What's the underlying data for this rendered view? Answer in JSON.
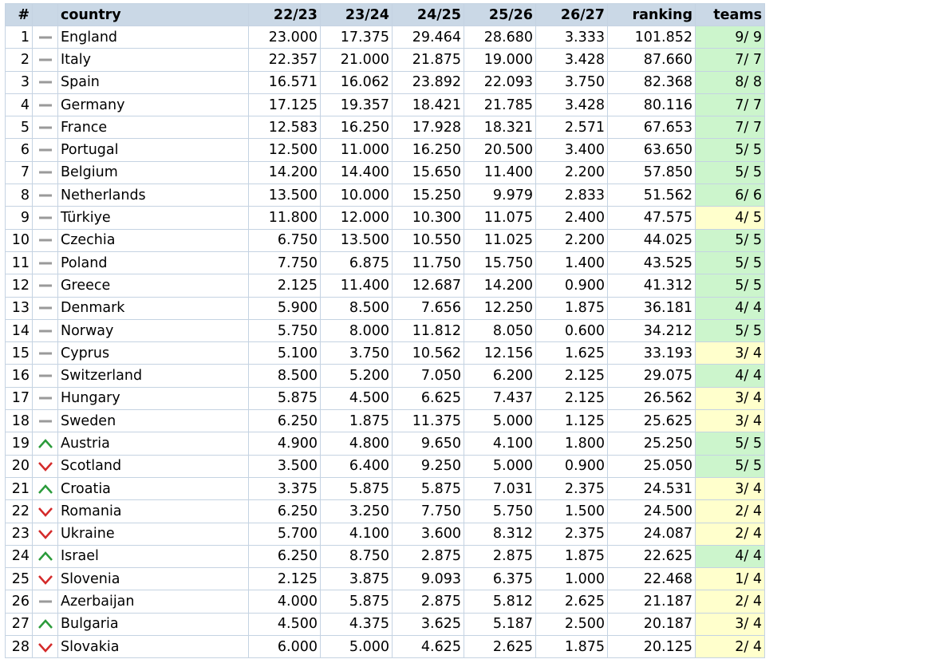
{
  "columns": [
    "#",
    "",
    "country",
    "22/23",
    "23/24",
    "24/25",
    "25/26",
    "26/27",
    "ranking",
    "teams"
  ],
  "colors": {
    "header_bg": "#cad8e6",
    "grid": "#c5d3e2",
    "teams_full": "#ccf5cc",
    "teams_partial": "#ffffcc",
    "trend_up": "#2a9b3a",
    "trend_down": "#d42a2a",
    "trend_same": "#9a9a9a"
  },
  "rows": [
    {
      "rank": "1",
      "trend": "same",
      "country": "England",
      "s1": "23.000",
      "s2": "17.375",
      "s3": "29.464",
      "s4": "28.680",
      "s5": "3.333",
      "ranking": "101.852",
      "teams": "9/ 9",
      "full": true
    },
    {
      "rank": "2",
      "trend": "same",
      "country": "Italy",
      "s1": "22.357",
      "s2": "21.000",
      "s3": "21.875",
      "s4": "19.000",
      "s5": "3.428",
      "ranking": "87.660",
      "teams": "7/ 7",
      "full": true
    },
    {
      "rank": "3",
      "trend": "same",
      "country": "Spain",
      "s1": "16.571",
      "s2": "16.062",
      "s3": "23.892",
      "s4": "22.093",
      "s5": "3.750",
      "ranking": "82.368",
      "teams": "8/ 8",
      "full": true
    },
    {
      "rank": "4",
      "trend": "same",
      "country": "Germany",
      "s1": "17.125",
      "s2": "19.357",
      "s3": "18.421",
      "s4": "21.785",
      "s5": "3.428",
      "ranking": "80.116",
      "teams": "7/ 7",
      "full": true
    },
    {
      "rank": "5",
      "trend": "same",
      "country": "France",
      "s1": "12.583",
      "s2": "16.250",
      "s3": "17.928",
      "s4": "18.321",
      "s5": "2.571",
      "ranking": "67.653",
      "teams": "7/ 7",
      "full": true
    },
    {
      "rank": "6",
      "trend": "same",
      "country": "Portugal",
      "s1": "12.500",
      "s2": "11.000",
      "s3": "16.250",
      "s4": "20.500",
      "s5": "3.400",
      "ranking": "63.650",
      "teams": "5/ 5",
      "full": true
    },
    {
      "rank": "7",
      "trend": "same",
      "country": "Belgium",
      "s1": "14.200",
      "s2": "14.400",
      "s3": "15.650",
      "s4": "11.400",
      "s5": "2.200",
      "ranking": "57.850",
      "teams": "5/ 5",
      "full": true
    },
    {
      "rank": "8",
      "trend": "same",
      "country": "Netherlands",
      "s1": "13.500",
      "s2": "10.000",
      "s3": "15.250",
      "s4": "9.979",
      "s5": "2.833",
      "ranking": "51.562",
      "teams": "6/ 6",
      "full": true
    },
    {
      "rank": "9",
      "trend": "same",
      "country": "Türkiye",
      "s1": "11.800",
      "s2": "12.000",
      "s3": "10.300",
      "s4": "11.075",
      "s5": "2.400",
      "ranking": "47.575",
      "teams": "4/ 5",
      "full": false
    },
    {
      "rank": "10",
      "trend": "same",
      "country": "Czechia",
      "s1": "6.750",
      "s2": "13.500",
      "s3": "10.550",
      "s4": "11.025",
      "s5": "2.200",
      "ranking": "44.025",
      "teams": "5/ 5",
      "full": true
    },
    {
      "rank": "11",
      "trend": "same",
      "country": "Poland",
      "s1": "7.750",
      "s2": "6.875",
      "s3": "11.750",
      "s4": "15.750",
      "s5": "1.400",
      "ranking": "43.525",
      "teams": "5/ 5",
      "full": true
    },
    {
      "rank": "12",
      "trend": "same",
      "country": "Greece",
      "s1": "2.125",
      "s2": "11.400",
      "s3": "12.687",
      "s4": "14.200",
      "s5": "0.900",
      "ranking": "41.312",
      "teams": "5/ 5",
      "full": true
    },
    {
      "rank": "13",
      "trend": "same",
      "country": "Denmark",
      "s1": "5.900",
      "s2": "8.500",
      "s3": "7.656",
      "s4": "12.250",
      "s5": "1.875",
      "ranking": "36.181",
      "teams": "4/ 4",
      "full": true
    },
    {
      "rank": "14",
      "trend": "same",
      "country": "Norway",
      "s1": "5.750",
      "s2": "8.000",
      "s3": "11.812",
      "s4": "8.050",
      "s5": "0.600",
      "ranking": "34.212",
      "teams": "5/ 5",
      "full": true
    },
    {
      "rank": "15",
      "trend": "same",
      "country": "Cyprus",
      "s1": "5.100",
      "s2": "3.750",
      "s3": "10.562",
      "s4": "12.156",
      "s5": "1.625",
      "ranking": "33.193",
      "teams": "3/ 4",
      "full": false
    },
    {
      "rank": "16",
      "trend": "same",
      "country": "Switzerland",
      "s1": "8.500",
      "s2": "5.200",
      "s3": "7.050",
      "s4": "6.200",
      "s5": "2.125",
      "ranking": "29.075",
      "teams": "4/ 4",
      "full": true
    },
    {
      "rank": "17",
      "trend": "same",
      "country": "Hungary",
      "s1": "5.875",
      "s2": "4.500",
      "s3": "6.625",
      "s4": "7.437",
      "s5": "2.125",
      "ranking": "26.562",
      "teams": "3/ 4",
      "full": false
    },
    {
      "rank": "18",
      "trend": "same",
      "country": "Sweden",
      "s1": "6.250",
      "s2": "1.875",
      "s3": "11.375",
      "s4": "5.000",
      "s5": "1.125",
      "ranking": "25.625",
      "teams": "3/ 4",
      "full": false
    },
    {
      "rank": "19",
      "trend": "up",
      "country": "Austria",
      "s1": "4.900",
      "s2": "4.800",
      "s3": "9.650",
      "s4": "4.100",
      "s5": "1.800",
      "ranking": "25.250",
      "teams": "5/ 5",
      "full": true
    },
    {
      "rank": "20",
      "trend": "down",
      "country": "Scotland",
      "s1": "3.500",
      "s2": "6.400",
      "s3": "9.250",
      "s4": "5.000",
      "s5": "0.900",
      "ranking": "25.050",
      "teams": "5/ 5",
      "full": true
    },
    {
      "rank": "21",
      "trend": "up",
      "country": "Croatia",
      "s1": "3.375",
      "s2": "5.875",
      "s3": "5.875",
      "s4": "7.031",
      "s5": "2.375",
      "ranking": "24.531",
      "teams": "3/ 4",
      "full": false
    },
    {
      "rank": "22",
      "trend": "down",
      "country": "Romania",
      "s1": "6.250",
      "s2": "3.250",
      "s3": "7.750",
      "s4": "5.750",
      "s5": "1.500",
      "ranking": "24.500",
      "teams": "2/ 4",
      "full": false
    },
    {
      "rank": "23",
      "trend": "down",
      "country": "Ukraine",
      "s1": "5.700",
      "s2": "4.100",
      "s3": "3.600",
      "s4": "8.312",
      "s5": "2.375",
      "ranking": "24.087",
      "teams": "2/ 4",
      "full": false
    },
    {
      "rank": "24",
      "trend": "up",
      "country": "Israel",
      "s1": "6.250",
      "s2": "8.750",
      "s3": "2.875",
      "s4": "2.875",
      "s5": "1.875",
      "ranking": "22.625",
      "teams": "4/ 4",
      "full": true
    },
    {
      "rank": "25",
      "trend": "down",
      "country": "Slovenia",
      "s1": "2.125",
      "s2": "3.875",
      "s3": "9.093",
      "s4": "6.375",
      "s5": "1.000",
      "ranking": "22.468",
      "teams": "1/ 4",
      "full": false
    },
    {
      "rank": "26",
      "trend": "same",
      "country": "Azerbaijan",
      "s1": "4.000",
      "s2": "5.875",
      "s3": "2.875",
      "s4": "5.812",
      "s5": "2.625",
      "ranking": "21.187",
      "teams": "2/ 4",
      "full": false
    },
    {
      "rank": "27",
      "trend": "up",
      "country": "Bulgaria",
      "s1": "4.500",
      "s2": "4.375",
      "s3": "3.625",
      "s4": "5.187",
      "s5": "2.500",
      "ranking": "20.187",
      "teams": "3/ 4",
      "full": false
    },
    {
      "rank": "28",
      "trend": "down",
      "country": "Slovakia",
      "s1": "6.000",
      "s2": "5.000",
      "s3": "4.625",
      "s4": "2.625",
      "s5": "1.875",
      "ranking": "20.125",
      "teams": "2/ 4",
      "full": false
    }
  ]
}
